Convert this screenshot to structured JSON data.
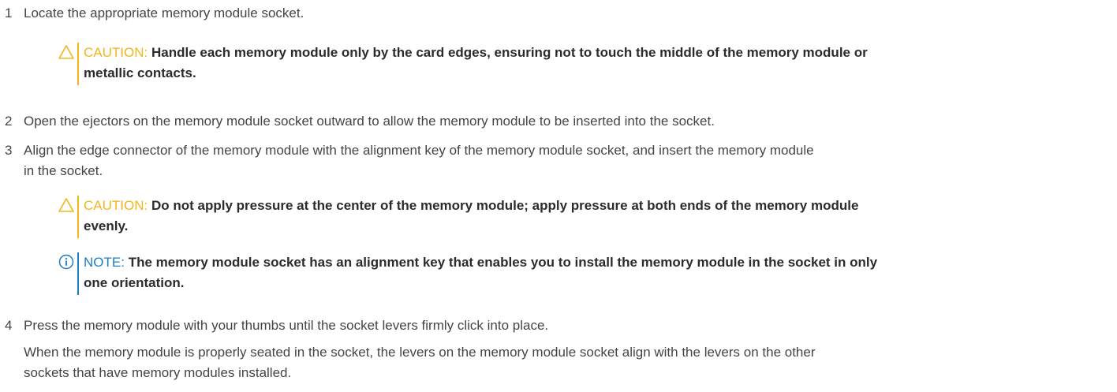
{
  "steps": [
    {
      "num": "1",
      "lines": [
        "Locate the appropriate memory module socket."
      ]
    },
    {
      "num": "2",
      "lines": [
        "Open the ejectors on the memory module socket outward to allow the memory module to be inserted into the socket."
      ]
    },
    {
      "num": "3",
      "lines": [
        "Align the edge connector of the memory module with the alignment key of the memory module socket, and insert the memory module",
        "in the socket."
      ]
    },
    {
      "num": "4",
      "lines": [
        "Press the memory module with your thumbs until the socket levers firmly click into place."
      ]
    }
  ],
  "step4_detail": {
    "lines": [
      "When the memory module is properly seated in the socket, the levers on the memory module socket align with the levers on the other",
      "sockets that have memory modules installed."
    ]
  },
  "notes": [
    {
      "type": "caution",
      "icon": "caution-triangle-icon",
      "label": "CAUTION:",
      "lines": [
        "Handle each memory module only by the card edges, ensuring not to touch the middle of the memory module or",
        "metallic contacts."
      ]
    },
    {
      "type": "caution",
      "icon": "caution-triangle-icon",
      "label": "CAUTION:",
      "lines": [
        "Do not apply pressure at the center of the memory module; apply pressure at both ends of the memory module",
        "evenly."
      ]
    },
    {
      "type": "note",
      "icon": "info-circle-icon",
      "label": "NOTE:",
      "lines": [
        "The memory module socket has an alignment key that enables you to install the memory module in the socket in only",
        "one orientation."
      ]
    }
  ],
  "colors": {
    "caution": "#f2b51c",
    "note": "#1a7fc4",
    "text": "#444444"
  }
}
